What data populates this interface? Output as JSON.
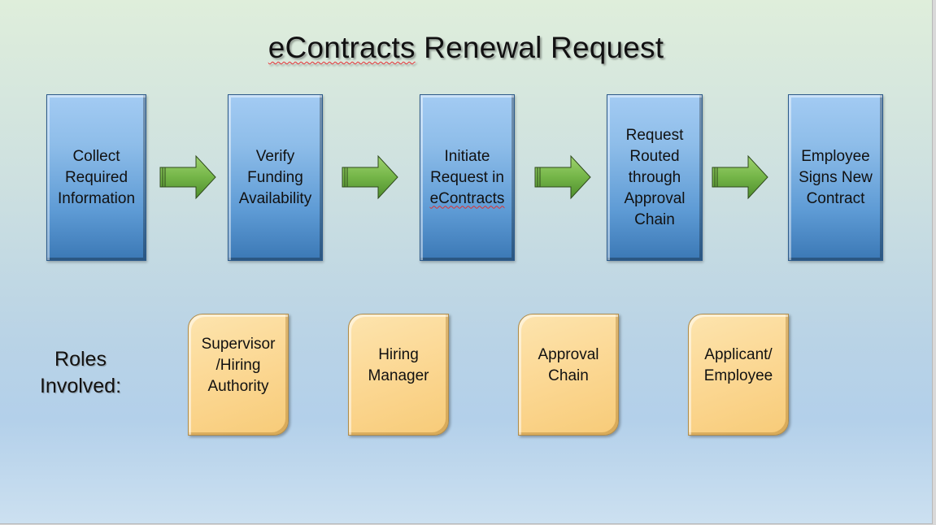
{
  "title": {
    "part1": "eContracts",
    "part2": " Renewal Request"
  },
  "steps": [
    {
      "label": "Collect\nRequired\nInformation"
    },
    {
      "label": "Verify\nFunding\nAvailability"
    },
    {
      "label_line1": "Initiate\nRequest in\n",
      "label_line2": "eContracts"
    },
    {
      "label": "Request\nRouted\nthrough\nApproval\nChain"
    },
    {
      "label": "Employee\nSigns New\nContract"
    }
  ],
  "arrows": [
    {
      "from": "Collect Required Information",
      "to": "Verify Funding Availability",
      "icon": "right-arrow-icon"
    },
    {
      "from": "Verify Funding Availability",
      "to": "Initiate Request in eContracts",
      "icon": "right-arrow-icon"
    },
    {
      "from": "Initiate Request in eContracts",
      "to": "Request Routed through Approval Chain",
      "icon": "right-arrow-icon"
    },
    {
      "from": "Request Routed through Approval Chain",
      "to": "Employee Signs New Contract",
      "icon": "right-arrow-icon"
    }
  ],
  "roles_label": "Roles\nInvolved:",
  "roles": [
    {
      "label": "Supervisor\n/Hiring\nAuthority"
    },
    {
      "label": "Hiring\nManager"
    },
    {
      "label": "Approval\nChain"
    },
    {
      "label": "Applicant/\nEmployee"
    }
  ],
  "colors": {
    "step_fill": "#5e9bd5",
    "arrow_fill": "#6aaa40",
    "role_fill": "#fbd690",
    "spellcheck_underline": "#e03030"
  }
}
